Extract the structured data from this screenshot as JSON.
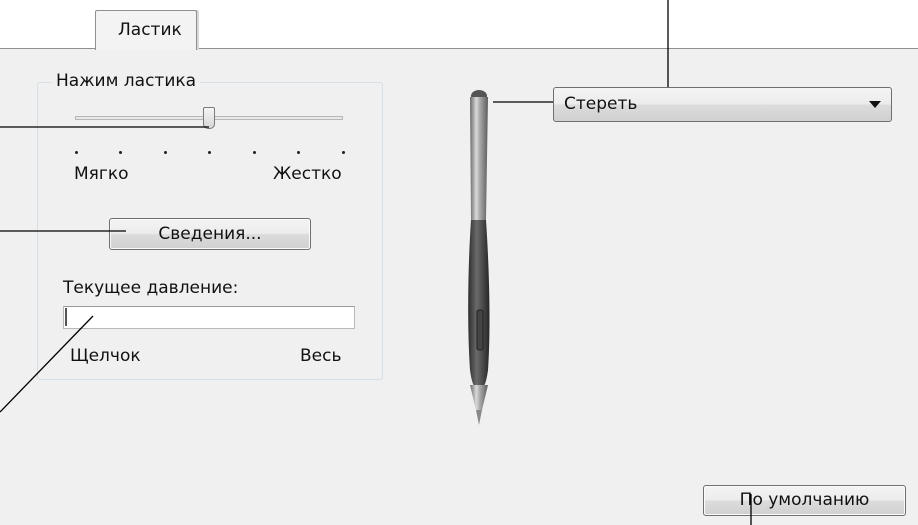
{
  "tabs": [
    {
      "label": "Ластик",
      "selected": true
    }
  ],
  "eraser_feel": {
    "group_title": "Нажим ластика",
    "slider": {
      "level_fraction": 0.5,
      "tick_count": 7,
      "min_label": "Мягко",
      "max_label": "Жестко"
    },
    "details_button": "Сведения..."
  },
  "current_pressure": {
    "label": "Текущее давление:",
    "level_fraction": 0,
    "min_label": "Щелчок",
    "max_label": "Весь"
  },
  "eraser_function": {
    "selected_value": "Стереть",
    "icon": "chevron-down-icon"
  },
  "footer": {
    "default_button": "По умолчанию"
  },
  "colors": {
    "panel_background": "#f0f0f0",
    "callout_lines": "#000000"
  }
}
